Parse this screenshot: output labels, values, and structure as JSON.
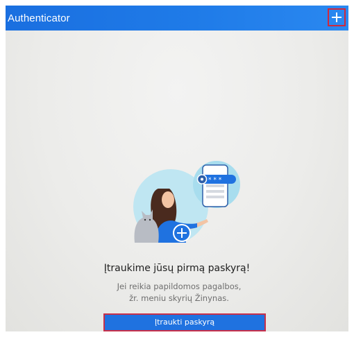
{
  "app_bar": {
    "title": "Authenticator",
    "add_icon": "plus-icon",
    "background": "#1f7be8"
  },
  "empty_state": {
    "illustration": "person-with-cat-and-phone-illustration",
    "headline": "Įtraukime jūsų pirmą paskyrą!",
    "help_text": "Jei reikia papildomos pagalbos, žr. meniu skyrių Žinynas.",
    "button_label": "Įtraukti paskyrą",
    "accent": "#1f72e0"
  },
  "highlight_color": "#d0283c"
}
